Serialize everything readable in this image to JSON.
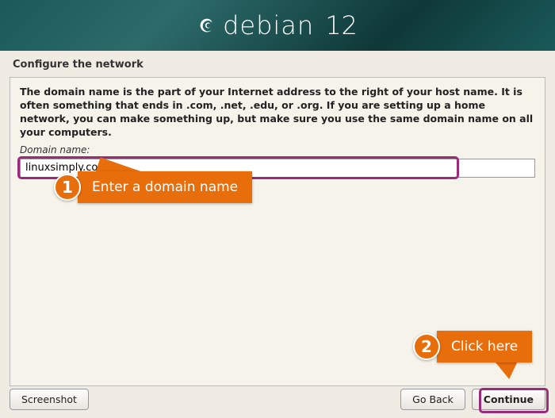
{
  "header": {
    "brand": "debian",
    "version": "12"
  },
  "section_title": "Configure the network",
  "instructions": "The domain name is the part of your Internet address to the right of your host name.  It is often something that ends in .com, .net, .edu, or .org.  If you are setting up a home network, you can make something up, but make sure you use the same domain name on all your computers.",
  "field": {
    "label": "Domain name:",
    "value": "linuxsimply.com"
  },
  "footer": {
    "screenshot": "Screenshot",
    "go_back": "Go Back",
    "continue": "Continue"
  },
  "annotations": {
    "step1_num": "1",
    "step1_label": "Enter a domain name",
    "step2_num": "2",
    "step2_label": "Click here"
  }
}
